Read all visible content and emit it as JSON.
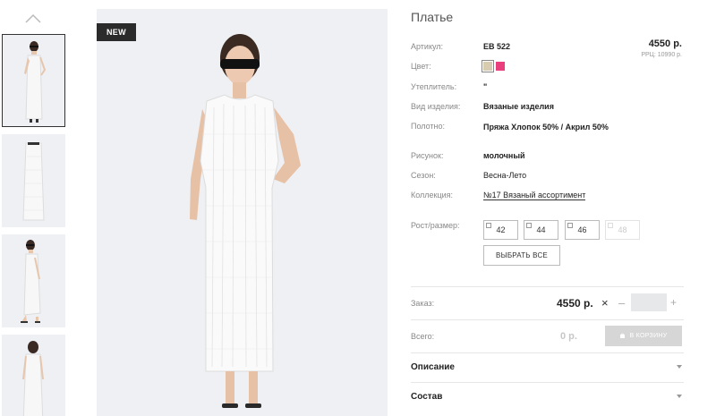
{
  "product": {
    "badge": "NEW",
    "title": "Платье",
    "price": "4550 р.",
    "rrp": "РРЦ: 10990 р."
  },
  "specs": [
    {
      "label": "Артикул:",
      "value": "EB 522"
    },
    {
      "label": "Цвет:",
      "value": ""
    },
    {
      "label": "Утеплитель:",
      "value": "\""
    },
    {
      "label": "Вид изделия:",
      "value": "Вязаные изделия"
    },
    {
      "label": "Полотно:",
      "value": "Пряжа Хлопок 50% / Акрил 50%"
    },
    {
      "label": "Рисунок:",
      "value": "молочный"
    },
    {
      "label": "Сезон:",
      "value": "Весна-Лето"
    },
    {
      "label": "Коллекция:",
      "value": "№17 Вязаный ассортимент"
    }
  ],
  "colors": [
    "#d8ccb0",
    "#ea3f7d"
  ],
  "sizes": {
    "label": "Рост/размер:",
    "options": [
      {
        "value": "42",
        "available": true
      },
      {
        "value": "44",
        "available": true
      },
      {
        "value": "46",
        "available": true
      },
      {
        "value": "48",
        "available": false
      }
    ],
    "select_all": "ВЫБРАТЬ ВСЕ"
  },
  "order": {
    "label": "Заказ:",
    "price": "4550 р.",
    "times": "×",
    "minus": "–",
    "plus": "+",
    "quantity": ""
  },
  "total": {
    "label": "Всего:",
    "value": "0 р.",
    "cart_button": "В КОРЗИНУ"
  },
  "accordion": {
    "description": "Описание",
    "composition": "Состав"
  },
  "icons": {
    "thumbs_up": "chevron-up-icon",
    "cart": "cart-icon",
    "accordion": "caret-down-icon"
  }
}
